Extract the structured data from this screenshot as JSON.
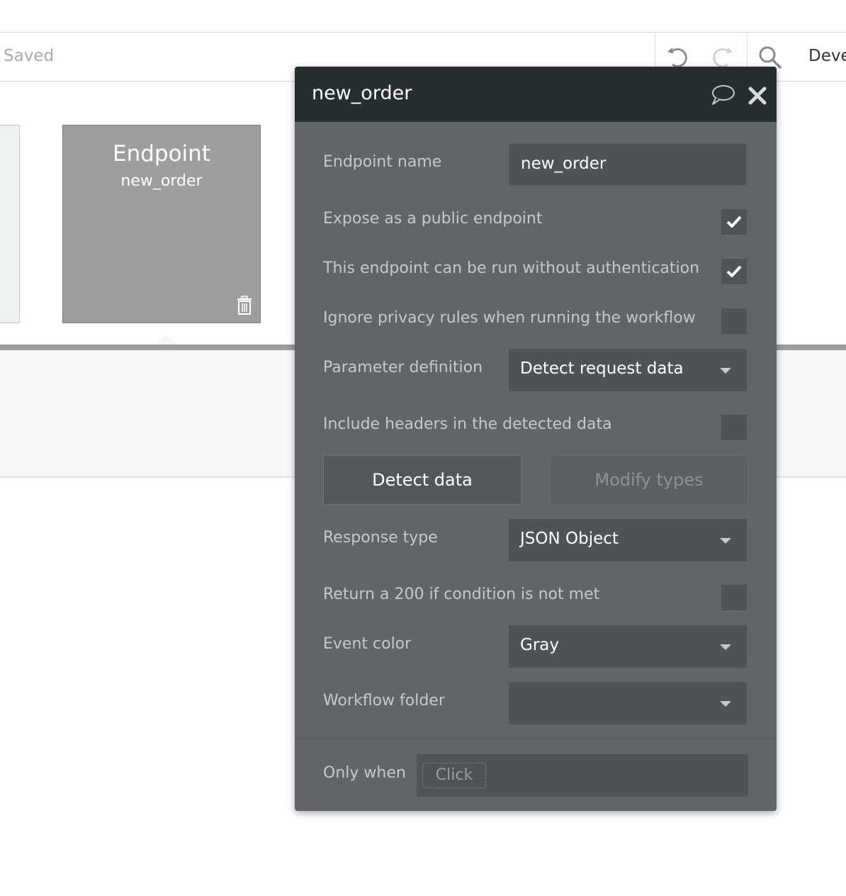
{
  "toolbar": {
    "status": "Saved",
    "menu_label": "Deve",
    "undo_icon": "undo-icon",
    "redo_icon": "redo-icon",
    "search_icon": "search-icon"
  },
  "canvas": {
    "card_title": "Endpoint",
    "card_subtitle": "new_order",
    "trash_icon": "trash-icon"
  },
  "modal": {
    "title": "new_order",
    "comment_icon": "comment-icon",
    "close_icon": "close-icon",
    "endpoint_name": {
      "label": "Endpoint name",
      "value": "new_order"
    },
    "expose_public": {
      "label": "Expose as a public endpoint",
      "checked": true
    },
    "no_auth": {
      "label": "This endpoint can be run without authentication",
      "checked": true
    },
    "ignore_privacy": {
      "label": "Ignore privacy rules when running the workflow",
      "checked": false
    },
    "parameter_definition": {
      "label": "Parameter definition",
      "value": "Detect request data"
    },
    "include_headers": {
      "label": "Include headers in the detected data",
      "checked": false
    },
    "detect_button": "Detect data",
    "modify_button": "Modify types",
    "response_type": {
      "label": "Response type",
      "value": "JSON Object"
    },
    "return_200": {
      "label": "Return a 200 if condition is not met",
      "checked": false
    },
    "event_color": {
      "label": "Event color",
      "value": "Gray"
    },
    "workflow_folder": {
      "label": "Workflow folder",
      "value": ""
    },
    "only_when": {
      "label": "Only when",
      "placeholder": "Click"
    }
  }
}
